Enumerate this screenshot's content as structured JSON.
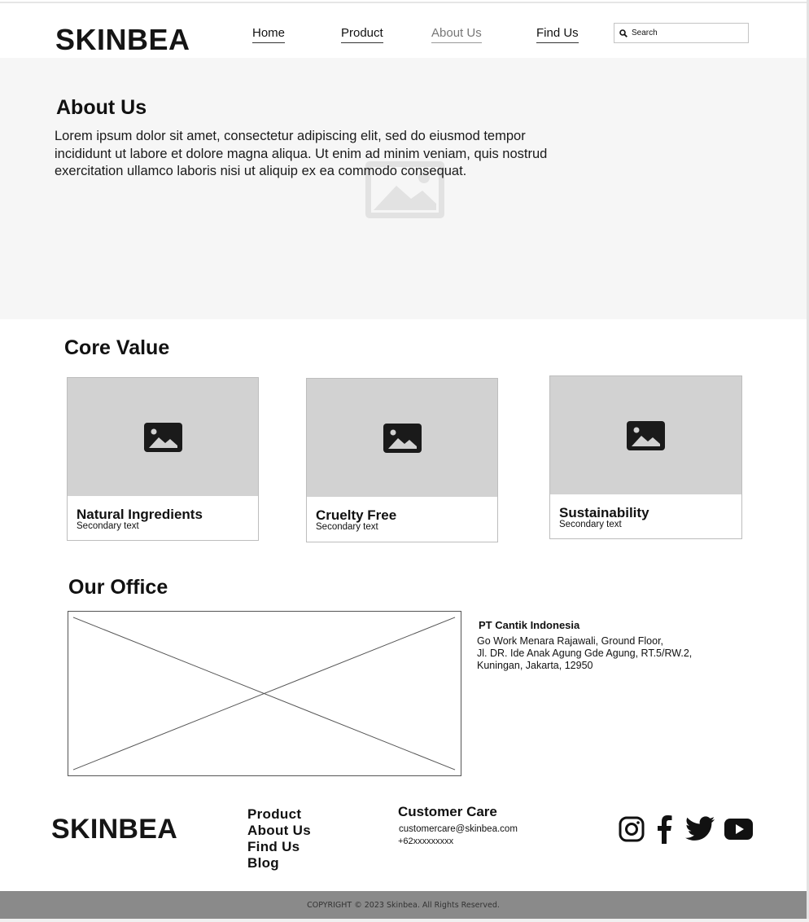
{
  "header": {
    "logo": "SKINBEA",
    "nav": [
      {
        "label": "Home",
        "active": false
      },
      {
        "label": "Product",
        "active": false
      },
      {
        "label": "About Us",
        "active": true
      },
      {
        "label": "Find Us",
        "active": false
      }
    ],
    "search": {
      "placeholder": "Search",
      "icon": "search-icon"
    }
  },
  "about": {
    "title": "About Us",
    "text": "Lorem ipsum dolor sit amet, consectetur adipiscing elit, sed do eiusmod tempor incididunt ut labore et dolore magna aliqua. Ut enim ad minim veniam, quis nostrud exercitation ullamco laboris nisi ut aliquip ex ea commodo consequat.",
    "background_image_icon": "image-placeholder-icon"
  },
  "core_value": {
    "title": "Core Value",
    "cards": [
      {
        "title": "Natural Ingredients",
        "subtitle": "Secondary text",
        "icon": "image-icon"
      },
      {
        "title": "Cruelty Free",
        "subtitle": "Secondary text",
        "icon": "image-icon"
      },
      {
        "title": "Sustainability",
        "subtitle": "Secondary text",
        "icon": "image-icon"
      }
    ]
  },
  "office": {
    "title": "Our Office",
    "company": "PT Cantik Indonesia",
    "address_lines": [
      "Go Work Menara Rajawali, Ground Floor,",
      "Jl. DR. Ide Anak Agung Gde Agung, RT.5/RW.2,",
      "Kuningan, Jakarta, 12950"
    ]
  },
  "footer": {
    "logo": "SKINBEA",
    "links": [
      "Product",
      "About Us",
      "Find Us",
      "Blog"
    ],
    "customer_care": {
      "title": "Customer Care",
      "email": "customercare@skinbea.com",
      "phone": "+62xxxxxxxxx"
    },
    "social_icons": [
      "instagram-icon",
      "facebook-icon",
      "twitter-icon",
      "youtube-icon"
    ],
    "copyright": "COPYRIGHT © 2023 Skinbea. All Rights Reserved."
  },
  "colors": {
    "hero_background": "#f6f6f6",
    "card_media": "#d2d2d2",
    "copyright_bar": "#8a8a8a",
    "active_nav": "#777777"
  }
}
